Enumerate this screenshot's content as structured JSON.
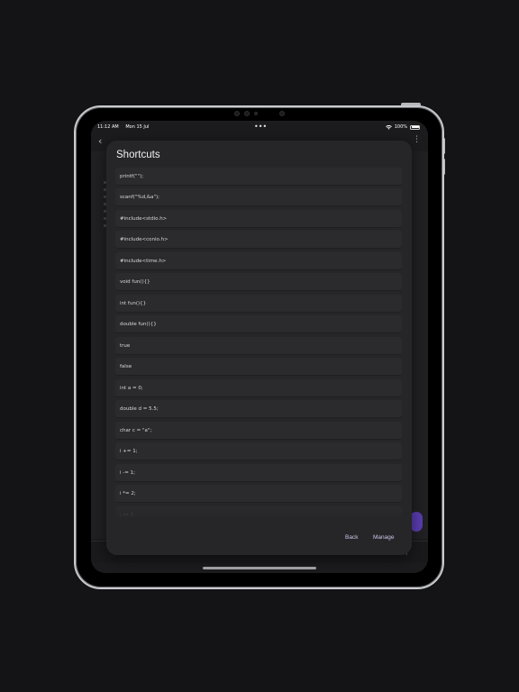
{
  "status_bar": {
    "time": "11:12 AM",
    "date": "Mon 15 Jul",
    "battery": "100%",
    "multitask_icon": "ellipsis-icon",
    "wifi_icon": "wifi-icon",
    "battery_icon": "battery-icon"
  },
  "background_app": {
    "back_icon": "chevron-left-icon",
    "more_icon": "more-vertical-icon"
  },
  "modal": {
    "title": "Shortcuts",
    "items": [
      "printf(\"\");",
      "scanf(\"%d,&a\");",
      "#include<stdio.h>",
      "#include<conio.h>",
      "#include<time.h>",
      "void fun(){}",
      "int fun(){}",
      "double fun(){}",
      "true",
      "false",
      "int a = 0;",
      "double d = 5.5;",
      "char c = \"a\";",
      "i += 1;",
      "i -= 1;",
      "i *= 2;",
      "i /= 2;"
    ],
    "back_label": "Back",
    "manage_label": "Manage"
  },
  "colors": {
    "accent": "#c9c7e8",
    "modal_bg": "#262629",
    "item_bg": "#2b2b2e",
    "fab": "#5b3fb5"
  }
}
